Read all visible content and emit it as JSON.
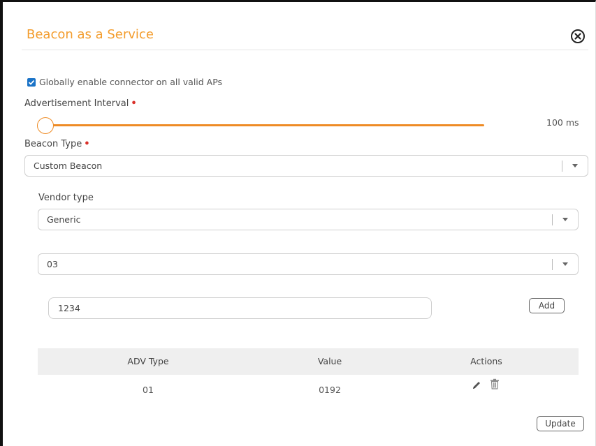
{
  "dialog": {
    "title": "Beacon as a Service"
  },
  "global_enable": {
    "label": "Globally enable connector on all valid APs",
    "checked": true
  },
  "advertisement_interval": {
    "label": "Advertisement Interval",
    "required_mark": "•",
    "value_text": "100 ms",
    "slider_position_fraction": 0.0
  },
  "beacon_type": {
    "label": "Beacon Type",
    "required_mark": "•",
    "selected": "Custom Beacon"
  },
  "vendor_type": {
    "label": "Vendor type",
    "selected": "Generic"
  },
  "adv_type_select": {
    "selected": "03"
  },
  "value_input": {
    "value": "1234"
  },
  "buttons": {
    "add": "Add",
    "update": "Update"
  },
  "table": {
    "columns": [
      "ADV Type",
      "Value",
      "Actions"
    ],
    "rows": [
      {
        "adv_type": "01",
        "value": "0192"
      }
    ]
  },
  "icons": {
    "close": "close-circle-icon",
    "edit": "pencil-icon",
    "delete": "trash-icon",
    "dropdown": "chevron-down-icon",
    "checkbox": "checkbox-checked-icon"
  },
  "colors": {
    "accent": "#f39c2c",
    "slider": "#ee8b25",
    "checkbox": "#1a73c7",
    "required": "#d9302a"
  }
}
